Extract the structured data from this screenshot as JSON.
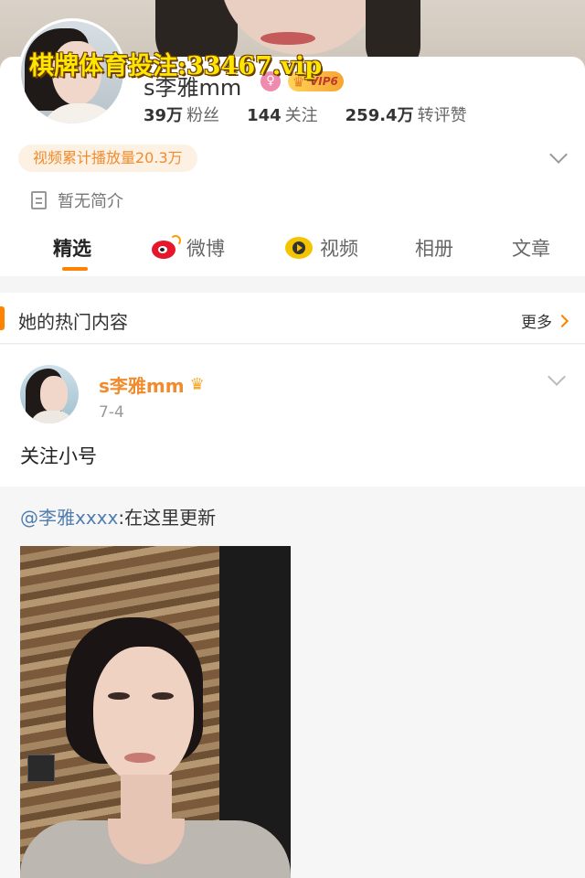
{
  "watermark": "棋牌体育投注:33467.vip",
  "profile": {
    "nickname": "s李雅mm",
    "gender_badge": "♀",
    "vip_label": "VIP6",
    "stats": [
      {
        "value": "39万",
        "label": "粉丝"
      },
      {
        "value": "144",
        "label": "关注"
      },
      {
        "value": "259.4万",
        "label": "转评赞"
      }
    ],
    "play_count_tag": "视频累计播放量20.3万",
    "bio": "暂无简介"
  },
  "tabs": [
    {
      "label": "精选",
      "active": true
    },
    {
      "label": "微博",
      "icon": "weibo-icon"
    },
    {
      "label": "视频",
      "icon": "video-icon"
    },
    {
      "label": "相册"
    },
    {
      "label": "文章"
    }
  ],
  "hot_section": {
    "title": "她的热门内容",
    "more_label": "更多"
  },
  "post": {
    "author": "s李雅mm",
    "date": "7-4",
    "text": "关注小号",
    "repost": {
      "mention": "@李雅xxxx",
      "text": ":在这里更新"
    }
  },
  "colors": {
    "accent": "#ff8200",
    "name_orange": "#f08c2e",
    "mention_blue": "#507daf",
    "watermark_yellow": "#ffe600"
  }
}
